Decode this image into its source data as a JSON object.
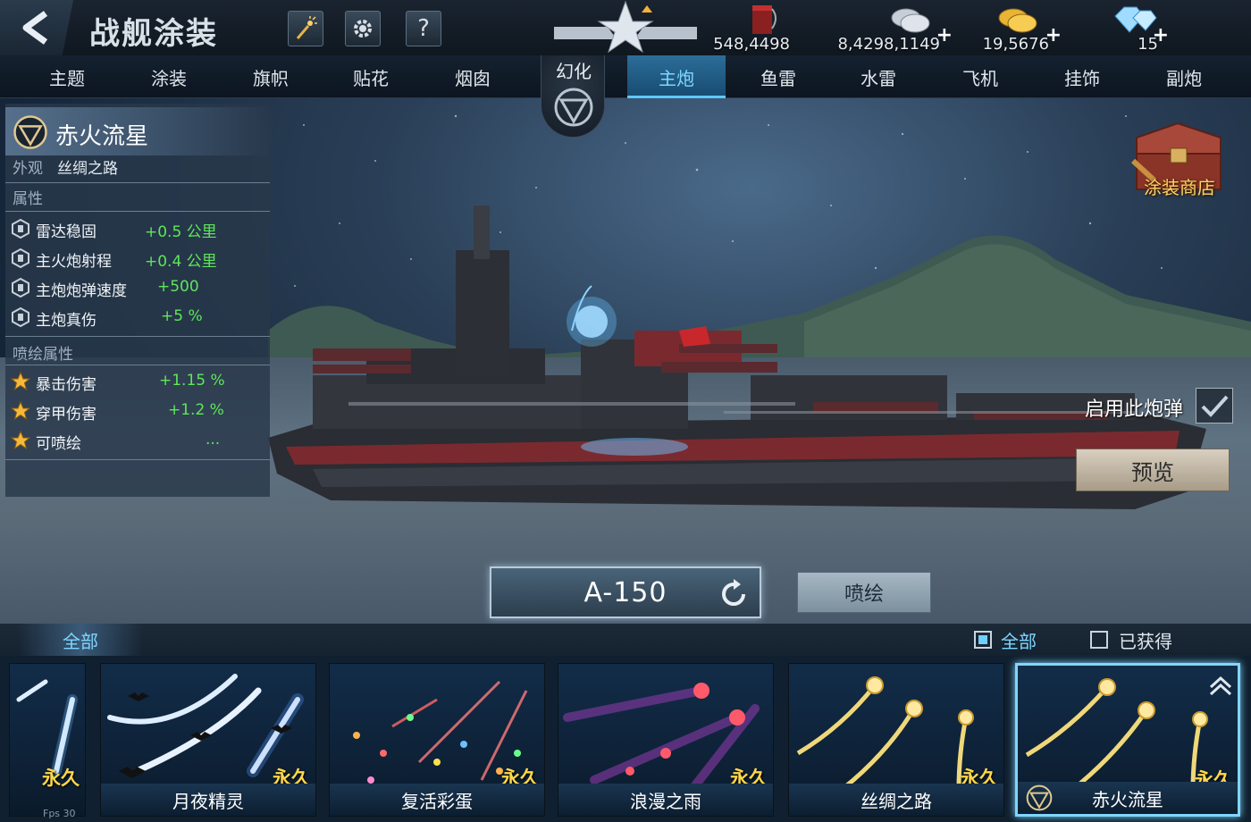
{
  "header": {
    "title": "战舰涂装",
    "currencies": [
      {
        "name": "paint",
        "value": "548,4498"
      },
      {
        "name": "silver",
        "value": "8,4298,1149"
      },
      {
        "name": "gold",
        "value": "19,5676"
      },
      {
        "name": "diamond",
        "value": "15"
      }
    ]
  },
  "tabs": {
    "items": [
      "主题",
      "涂装",
      "旗帜",
      "贴花",
      "烟囱",
      "主炮",
      "鱼雷",
      "水雷",
      "飞机",
      "挂饰",
      "副炮"
    ],
    "active": "主炮",
    "transform_label": "幻化"
  },
  "info": {
    "skin_name": "赤火流星",
    "appearance_label": "外观",
    "appearance_value": "丝绸之路",
    "attributes_label": "属性",
    "attributes": [
      {
        "name": "雷达稳固",
        "value": "+0.5 公里"
      },
      {
        "name": "主火炮射程",
        "value": "+0.4 公里"
      },
      {
        "name": "主炮炮弹速度",
        "value": "+500"
      },
      {
        "name": "主炮真伤",
        "value": "+5 %"
      }
    ],
    "paint_attributes_label": "喷绘属性",
    "paint_attributes": [
      {
        "name": "暴击伤害",
        "value": "+1.15 %"
      },
      {
        "name": "穿甲伤害",
        "value": "+1.2 %"
      },
      {
        "name": "可喷绘",
        "value": "..."
      }
    ]
  },
  "side": {
    "shop_label": "涂装商店",
    "enable_label": "启用此炮弹",
    "enable_checked": true,
    "preview_label": "预览"
  },
  "controls": {
    "shell_name": "A-150",
    "paint_label": "喷绘"
  },
  "filter": {
    "tab_all": "全部",
    "check_all": "全部",
    "check_all_on": true,
    "check_obtained": "已获得",
    "check_obtained_on": false
  },
  "cards": [
    {
      "name": "",
      "tag": "永久"
    },
    {
      "name": "月夜精灵",
      "tag": "永久"
    },
    {
      "name": "复活彩蛋",
      "tag": "永久"
    },
    {
      "name": "浪漫之雨",
      "tag": "永久"
    },
    {
      "name": "丝绸之路",
      "tag": "永久"
    },
    {
      "name": "赤火流星",
      "tag": "永久",
      "selected": true
    }
  ],
  "fps": "Fps 30",
  "colors": {
    "accent": "#7fd6ff",
    "bonus_green": "#5ee65a",
    "permanent_gold": "#ffd84a"
  }
}
